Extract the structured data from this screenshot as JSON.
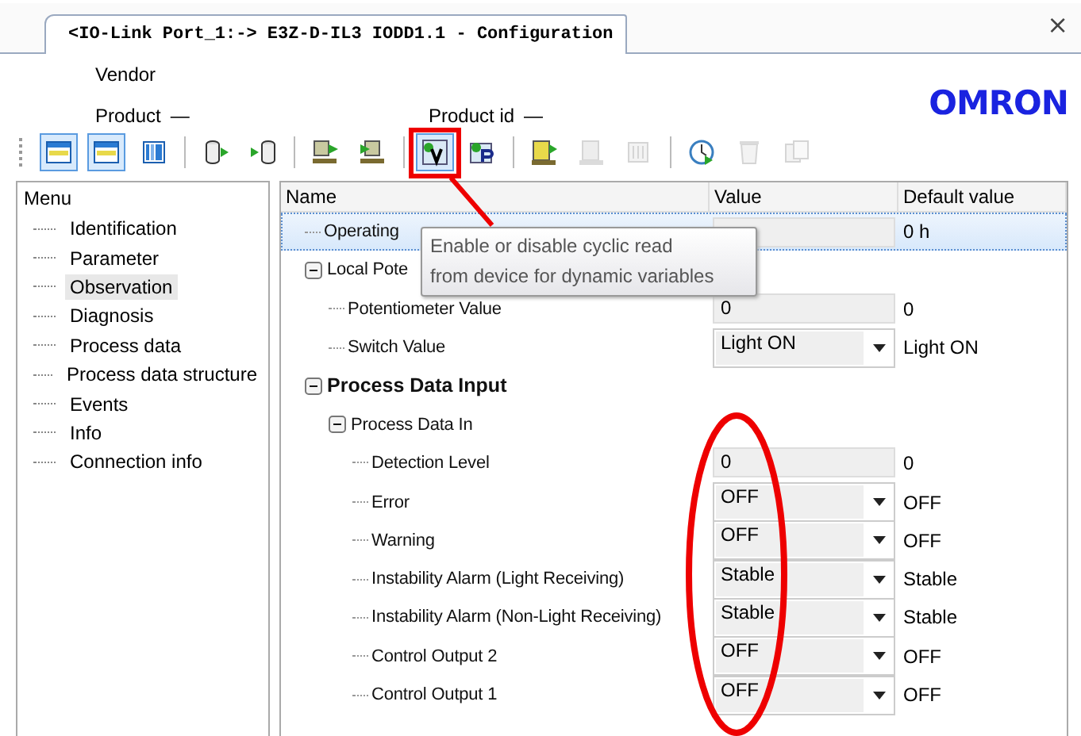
{
  "tab": {
    "title": "<IO-Link Port_1:-> E3Z-D-IL3 IODD1.1 - Configuration",
    "close": "×"
  },
  "header": {
    "vendor_label": "Vendor",
    "product_label": "Product",
    "product_value": "—",
    "product_id_label": "Product id",
    "product_id_value": "—",
    "logo": "OMRON"
  },
  "toolbar": [
    [
      {
        "kind": "window-top",
        "on": true,
        "disabled": false
      },
      {
        "kind": "window-top",
        "on": true,
        "disabled": false
      },
      {
        "kind": "columns",
        "on": false,
        "disabled": false
      }
    ],
    [
      {
        "kind": "cylinder-out",
        "on": false,
        "disabled": false
      },
      {
        "kind": "cylinder-in",
        "on": false,
        "disabled": false
      }
    ],
    [
      {
        "kind": "device-up",
        "on": false,
        "disabled": false
      },
      {
        "kind": "device-down",
        "on": false,
        "disabled": false
      }
    ],
    [
      {
        "kind": "read-v",
        "on": true,
        "disabled": false
      },
      {
        "kind": "read-p",
        "on": false,
        "disabled": false
      }
    ],
    [
      {
        "kind": "device-help",
        "on": false,
        "disabled": false
      },
      {
        "kind": "device-grid",
        "on": false,
        "disabled": true
      },
      {
        "kind": "list",
        "on": false,
        "disabled": true
      }
    ],
    [
      {
        "kind": "clock",
        "on": false,
        "disabled": false
      },
      {
        "kind": "trash",
        "on": false,
        "disabled": true
      },
      {
        "kind": "copy",
        "on": false,
        "disabled": true
      }
    ]
  ],
  "menu": {
    "title": "Menu",
    "items": [
      {
        "label": "Identification",
        "selected": false
      },
      {
        "label": "Parameter",
        "selected": false
      },
      {
        "label": "Observation",
        "selected": true
      },
      {
        "label": "Diagnosis",
        "selected": false
      },
      {
        "label": "Process data",
        "selected": false
      },
      {
        "label": "Process data structure",
        "selected": false
      },
      {
        "label": "Events",
        "selected": false
      },
      {
        "label": "Info",
        "selected": false
      },
      {
        "label": "Connection info",
        "selected": false
      }
    ]
  },
  "table": {
    "columns": [
      "Name",
      "Value",
      "Default value"
    ],
    "rows": [
      {
        "name": "Operating",
        "kind": "field",
        "default": "0 h",
        "selected": true
      },
      {
        "name": "Local Pote",
        "kind": "group",
        "expanded": true,
        "selected": false,
        "children": [
          {
            "name": "Potentiometer Value",
            "kind": "field",
            "value": "0",
            "default": "0",
            "selected": false
          },
          {
            "name": "Switch Value",
            "kind": "select",
            "value": "Light ON",
            "default": "Light ON",
            "selected": false
          }
        ]
      },
      {
        "name": "Process Data Input",
        "kind": "section",
        "expanded": true,
        "selected": false,
        "children": [
          {
            "name": "Process Data In",
            "kind": "group",
            "expanded": true,
            "selected": false,
            "children": [
              {
                "name": "Detection Level",
                "kind": "field",
                "value": "0",
                "default": "0",
                "selected": false
              },
              {
                "name": "Error",
                "kind": "select",
                "value": "OFF",
                "default": "OFF",
                "selected": false
              },
              {
                "name": "Warning",
                "kind": "select",
                "value": "OFF",
                "default": "OFF",
                "selected": false
              },
              {
                "name": "Instability Alarm (Light Receiving)",
                "kind": "select",
                "value": "Stable",
                "default": "Stable",
                "selected": false
              },
              {
                "name": "Instability Alarm (Non-Light Receiving)",
                "kind": "select",
                "value": "Stable",
                "default": "Stable",
                "selected": false
              },
              {
                "name": "Control Output 2",
                "kind": "select",
                "value": "OFF",
                "default": "OFF",
                "selected": false
              },
              {
                "name": "Control Output 1",
                "kind": "select",
                "value": "OFF",
                "default": "OFF",
                "selected": false
              }
            ]
          }
        ]
      }
    ]
  },
  "tooltip": "Enable or disable cyclic read\nfrom device for dynamic variables"
}
